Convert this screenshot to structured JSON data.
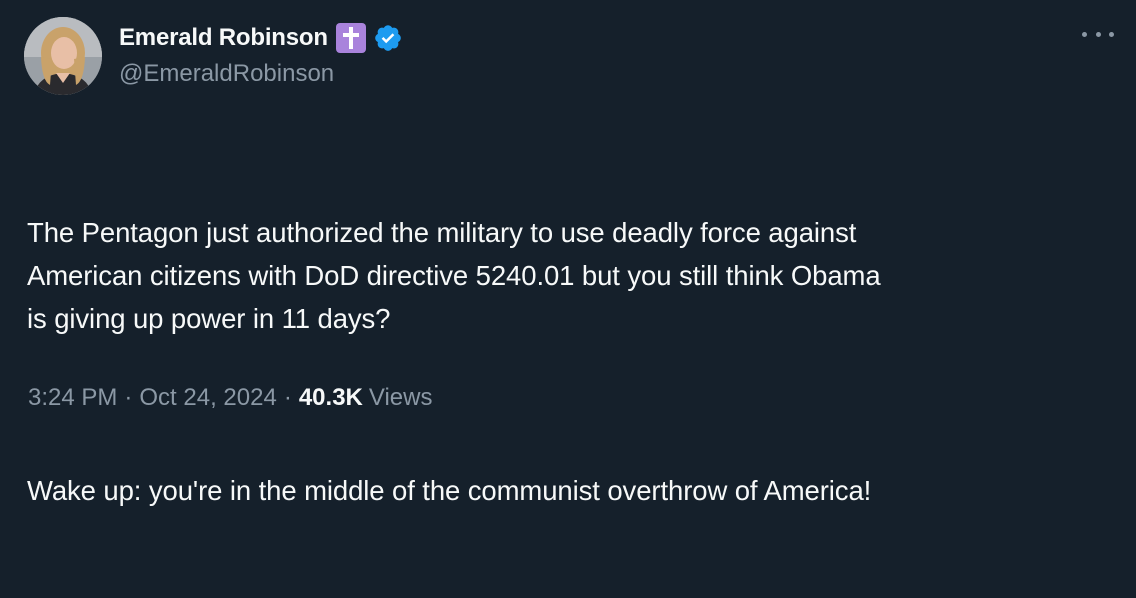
{
  "tweet": {
    "author": {
      "display_name": "Emerald Robinson",
      "handle": "@EmeraldRobinson",
      "badge_emoji": "latin-cross-emoji",
      "verified_icon": "verified-badge-icon",
      "verified_color": "#1d9bf0"
    },
    "text_paragraphs": [
      "The Pentagon just authorized the military to use deadly force against\nAmerican citizens with DoD directive 5240.01 but you still think Obama\nis giving up power in 11 days?",
      "Wake up: you're in the middle of the communist overthrow of America!"
    ],
    "time": "3:24 PM",
    "date": "Oct 24, 2024",
    "separator": "·",
    "views_count": "40.3K",
    "views_label": "Views",
    "more_icon": "more-dots-icon"
  },
  "colors": {
    "background": "#15202b",
    "primary_text": "#f7f9f9",
    "secondary_text": "#8b98a5",
    "badge_purple": "#a983dc"
  }
}
